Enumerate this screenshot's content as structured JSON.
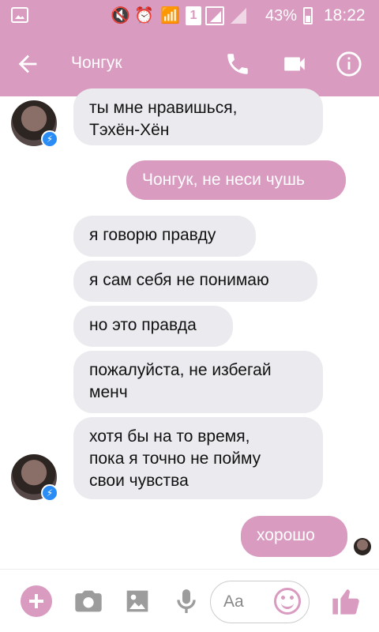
{
  "status": {
    "battery": "43%",
    "time": "18:22",
    "sim": "1"
  },
  "header": {
    "title": "Чонгук"
  },
  "messages": [
    {
      "side": "in",
      "text": "ты мне нравишься,\nТэхён-Хён"
    },
    {
      "side": "out",
      "text": "Чонгук, не неси чушь"
    },
    {
      "side": "in",
      "text": "я говорю правду"
    },
    {
      "side": "in",
      "text": "я сам себя не понимаю"
    },
    {
      "side": "in",
      "text": "но это правда"
    },
    {
      "side": "in",
      "text": "пожалуйста, не избегай\nменч"
    },
    {
      "side": "in",
      "text": "хотя бы на то время,\nпока я точно не пойму\nсвои чувства"
    },
    {
      "side": "out",
      "text": "хорошо"
    }
  ],
  "composer": {
    "placeholder": "Aa"
  },
  "colors": {
    "accent": "#d99bc0",
    "incoming": "#ebeaee",
    "messenger_badge": "#2a8cf5"
  },
  "icons": [
    "back-arrow-icon",
    "phone-icon",
    "video-icon",
    "info-icon",
    "plus-icon",
    "camera-icon",
    "image-icon",
    "microphone-icon",
    "emoji-icon",
    "thumbs-up-icon"
  ]
}
